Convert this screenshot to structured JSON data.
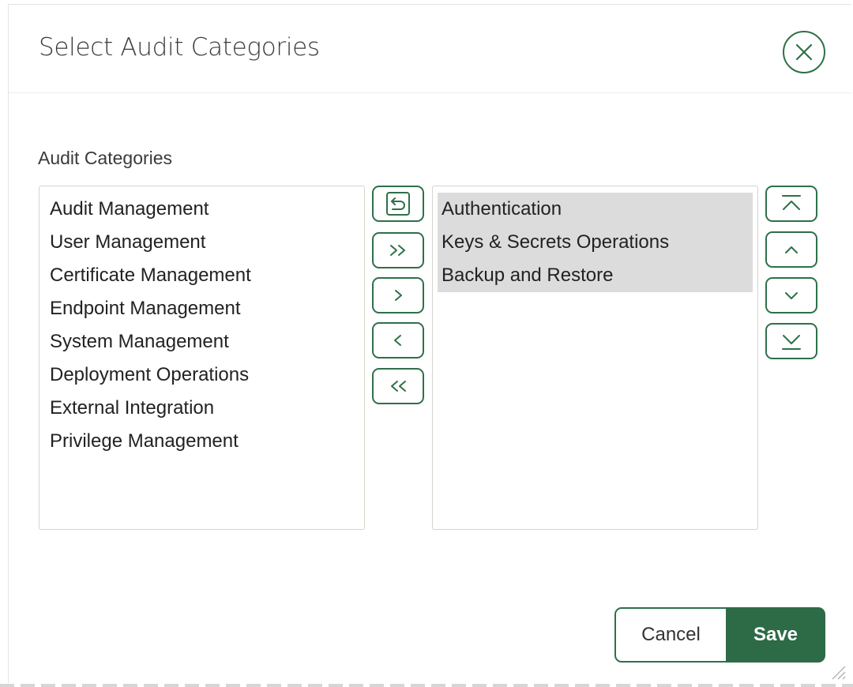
{
  "dialog": {
    "title": "Select Audit Categories",
    "close_icon": "close-circle-icon"
  },
  "picker": {
    "label": "Audit Categories",
    "available": [
      "Audit Management",
      "User Management",
      "Certificate Management",
      "Endpoint Management",
      "System Management",
      "Deployment Operations",
      "External Integration",
      "Privilege Management"
    ],
    "selected": [
      "Authentication",
      "Keys & Secrets Operations",
      "Backup and Restore"
    ],
    "shuttle_buttons": [
      {
        "name": "reset-button",
        "icon": "reset-icon"
      },
      {
        "name": "move-all-right-button",
        "icon": "double-chevron-right-icon"
      },
      {
        "name": "move-right-button",
        "icon": "chevron-right-icon"
      },
      {
        "name": "move-left-button",
        "icon": "chevron-left-icon"
      },
      {
        "name": "move-all-left-button",
        "icon": "double-chevron-left-icon"
      }
    ],
    "order_buttons": [
      {
        "name": "move-top-button",
        "icon": "move-top-icon"
      },
      {
        "name": "move-up-button",
        "icon": "chevron-up-icon"
      },
      {
        "name": "move-down-button",
        "icon": "chevron-down-icon"
      },
      {
        "name": "move-bottom-button",
        "icon": "move-bottom-icon"
      }
    ]
  },
  "footer": {
    "cancel_label": "Cancel",
    "save_label": "Save"
  },
  "colors": {
    "accent": "#2e7049",
    "save_bg": "#2d6b47",
    "selected_bg": "#dcdcdc"
  }
}
